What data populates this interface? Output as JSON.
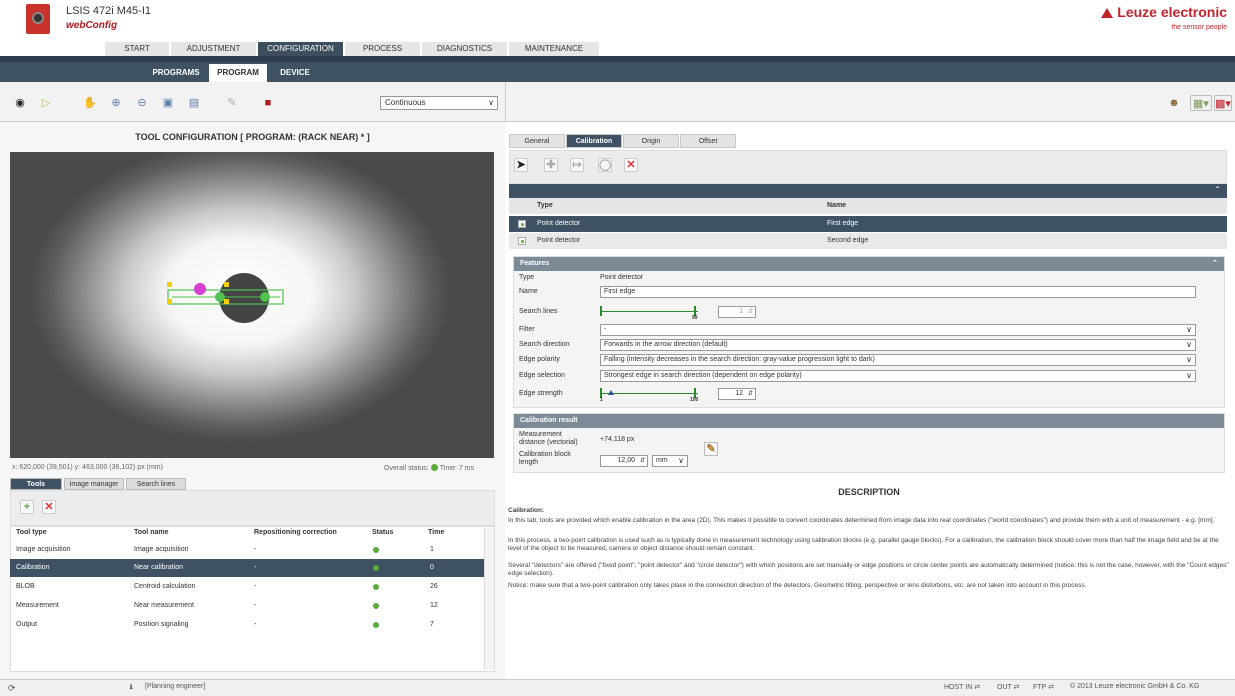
{
  "header": {
    "device": "LSIS 472i M45-I1",
    "app": "webConfig",
    "brand": "Leuze electronic",
    "slogan": "the sensor people"
  },
  "main_nav": [
    "START",
    "ADJUSTMENT",
    "CONFIGURATION",
    "PROCESS",
    "DIAGNOSTICS",
    "MAINTENANCE"
  ],
  "sub_nav": [
    "PROGRAMS",
    "PROGRAM",
    "DEVICE"
  ],
  "toolbar": {
    "mode": "Continuous"
  },
  "left": {
    "title": "TOOL CONFIGURATION   [ PROGRAM: (RACK NEAR) * ]",
    "coords": "x: 620,000 (39,501) y: 463,000 (36,102) px (mm)",
    "overall_status": "Overall status:",
    "time": "Time: 7 ms",
    "tabs": [
      "Tools",
      "Image manager",
      "Search lines"
    ],
    "table": {
      "headers": [
        "Tool type",
        "Tool name",
        "Repositioning correction",
        "Status",
        "Time"
      ],
      "rows": [
        {
          "type": "Image acquisition",
          "name": "Image acquisition",
          "repo": "-",
          "time": "1"
        },
        {
          "type": "Calibration",
          "name": "Near calibration",
          "repo": "-",
          "time": "0"
        },
        {
          "type": "BLOB",
          "name": "Centroid calculation",
          "repo": "-",
          "time": "26"
        },
        {
          "type": "Measurement",
          "name": "Near measurement",
          "repo": "-",
          "time": "12"
        },
        {
          "type": "Output",
          "name": "Position signaling",
          "repo": "-",
          "time": "7"
        }
      ]
    }
  },
  "right": {
    "tabs": [
      "General",
      "Calibration",
      "Origin",
      "Offset"
    ],
    "detectors": {
      "headers": [
        "Type",
        "Name"
      ],
      "rows": [
        {
          "type": "Point detector",
          "name": "First edge"
        },
        {
          "type": "Point detector",
          "name": "Second edge"
        }
      ]
    },
    "features": {
      "title": "Features",
      "type_label": "Type",
      "type_value": "Point detector",
      "name_label": "Name",
      "name_value": "First edge",
      "search_lines_label": "Search lines",
      "search_lines_max": "99",
      "search_lines_value": "1",
      "filter_label": "Filter",
      "filter_value": "-",
      "direction_label": "Search direction",
      "direction_value": "Forwards in the arrow direction (default)",
      "polarity_label": "Edge polarity",
      "polarity_value": "Falling (intensity decreases in the search direction: gray-value progression light to dark)",
      "selection_label": "Edge selection",
      "selection_value": "Strongest edge in search direction (dependent on edge polarity)",
      "strength_label": "Edge strength",
      "strength_min": "1",
      "strength_max": "100",
      "strength_value": "12"
    },
    "calib_result": {
      "title": "Calibration result",
      "measurement_label": "Measurement distance (vectorial)",
      "measurement_value": "+74,118  px",
      "block_label": "Calibration block length",
      "block_value": "12,00",
      "unit": "mm"
    },
    "description": {
      "title": "DESCRIPTION",
      "heading": "Calibration:",
      "p1": "In this tab, tools are provided which enable calibration in the area (2D). This makes it possible to convert coordinates determined from image data into real coordinates (\"world coordinates\") and provide them with a unit of measurement - e.g. [mm].",
      "p2": "In this process, a two-point calibration is used such as is typically done in measurement technology using calibration blocks (e.g. parallel gauge blocks). For a calibration, the calibration block should cover more than half the image field and be at the level of the object to be measured, camera or object distance should remain constant.",
      "p3": "Several \"detectors\" are offered (\"fixed point\", \"point detector\" and \"circle detector\") with which positions are set manually or edge positions or circle center points are automatically determined (notice: this is not the case, however, with the \"Count edges\" edge selection).",
      "p4": "Notice: make sure that a two-point calibration only takes place in the connection direction of the detectors. Geometric tilting, perspective or lens distortions, etc. are not taken into account in this process."
    }
  },
  "statusbar": {
    "user": "[Planning engineer]",
    "host": "HOST IN",
    "out": "OUT",
    "ftp": "FTP",
    "copyright": "© 2013 Leuze electronic GmbH & Co. KG"
  },
  "colors": {
    "nav_dark": "#3e5263",
    "brand_red": "#c0242c",
    "status_green": "#5aac3c"
  }
}
